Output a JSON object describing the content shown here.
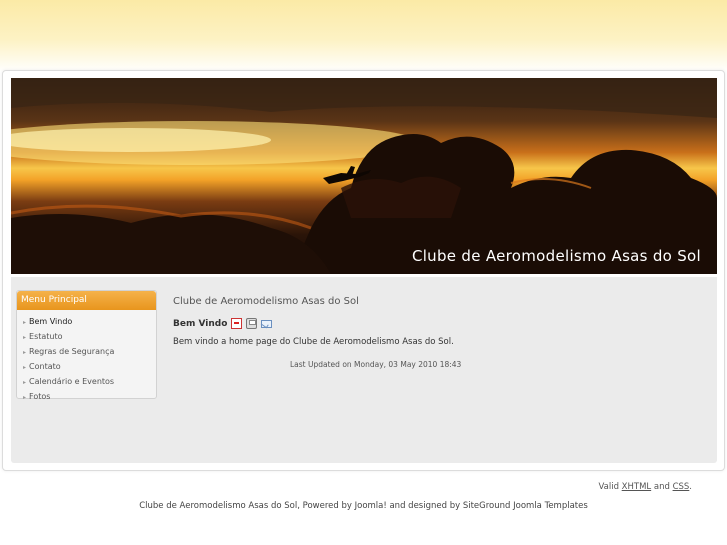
{
  "header": {
    "site_title": "Clube de Aeromodelismo Asas do Sol"
  },
  "menu": {
    "title": "Menu Principal",
    "items": [
      {
        "label": "Bem Vindo",
        "active": true
      },
      {
        "label": "Estatuto"
      },
      {
        "label": "Regras de Segurança"
      },
      {
        "label": "Contato"
      },
      {
        "label": "Calendário e Eventos"
      },
      {
        "label": "Fotos"
      }
    ]
  },
  "main": {
    "title": "Clube de Aeromodelismo Asas do Sol",
    "article_title": "Bem Vindo",
    "icons": [
      "pdf-icon",
      "print-icon",
      "email-icon"
    ],
    "body": "Bem vindo a home page do Clube de Aeromodelismo Asas do Sol.",
    "last_updated": "Last Updated on Monday, 03 May 2010 18:43"
  },
  "validation": {
    "prefix": "Valid",
    "xhtml": "XHTML",
    "and": "and",
    "css": "CSS",
    "suffix": "."
  },
  "footer": {
    "text": "Clube de Aeromodelismo Asas do Sol, Powered by Joomla! and designed by SiteGround Joomla Templates"
  },
  "colors": {
    "menu_header": "#e8951d",
    "top_band": "#fbeaa6",
    "content_bg": "#ebebeb"
  }
}
